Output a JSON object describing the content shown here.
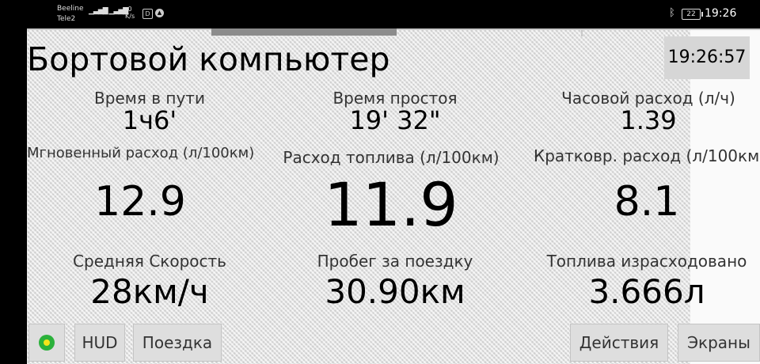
{
  "status_bar": {
    "operator_1": "Beeline",
    "operator_2": "Tele2",
    "network_speed_value": "0",
    "network_speed_unit": "K/s",
    "battery_level": "22",
    "time": "19:26",
    "icons": [
      "signal-icon",
      "bluetooth-icon",
      "battery-icon"
    ]
  },
  "app": {
    "title": "Бортовой компьютер",
    "current_time": "19:26:57",
    "metrics": {
      "travel_time": {
        "label": "Время в пути",
        "value": "1ч6'"
      },
      "idle_time": {
        "label": "Время простоя",
        "value": "19' 32\""
      },
      "hourly_consumption": {
        "label": "Часовой расход (л/ч)",
        "value": "1.39"
      },
      "instant_consumption": {
        "label": "Мгновенный расход (л/100км)",
        "value": "12.9"
      },
      "fuel_consumption": {
        "label": "Расход топлива (л/100км)",
        "value": "11.9"
      },
      "short_term_consumption": {
        "label": "Кратковр. расход (л/100км)",
        "value": "8.1"
      },
      "average_speed": {
        "label": "Средняя Скорость",
        "value": "28км/ч"
      },
      "trip_distance": {
        "label": "Пробег за поездку",
        "value": "30.90км"
      },
      "fuel_used": {
        "label": "Топлива израсходовано",
        "value": "3.666л"
      }
    },
    "buttons": {
      "hud": "HUD",
      "trip": "Поездка",
      "actions": "Действия",
      "screens": "Экраны"
    },
    "colors": {
      "status_green": "#2bb13b",
      "status_yellow": "#f5e51a"
    }
  }
}
